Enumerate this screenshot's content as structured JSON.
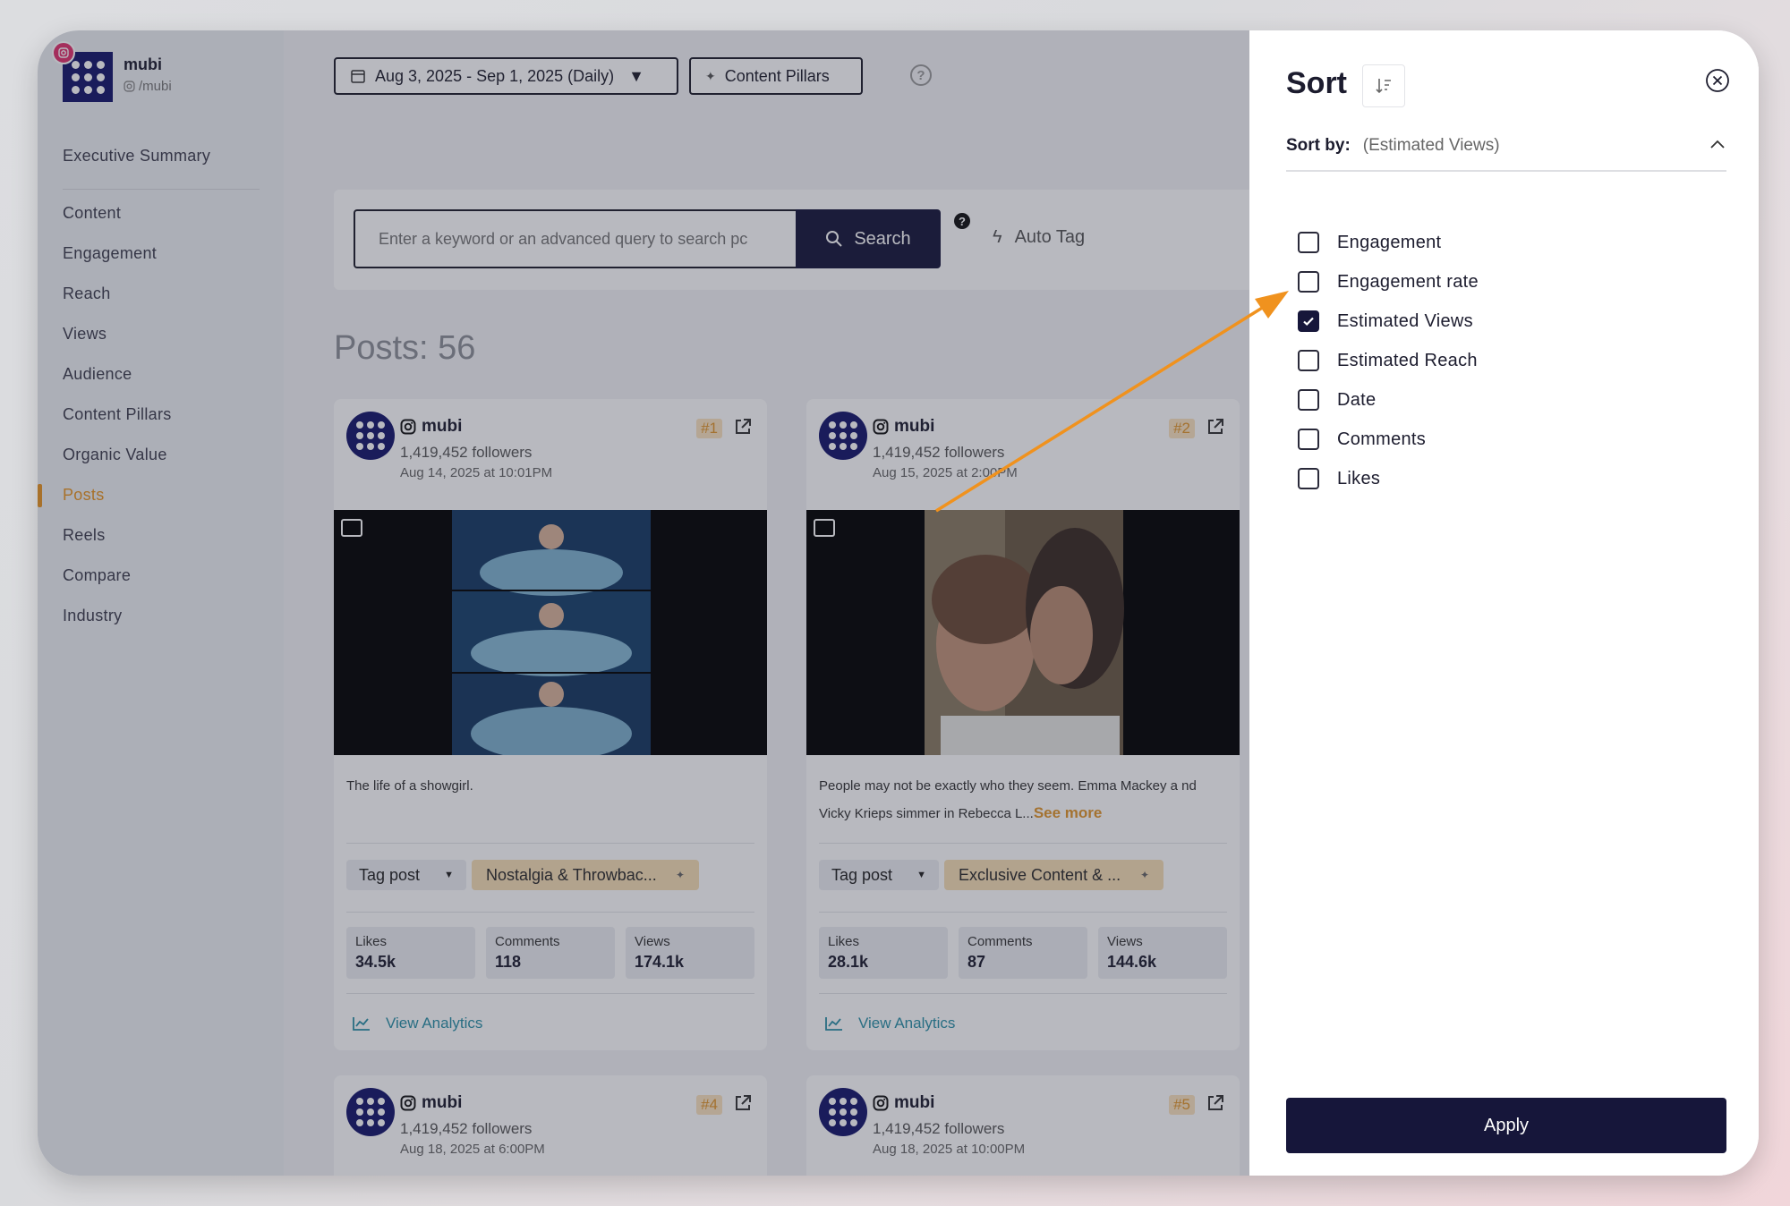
{
  "brand": {
    "name": "mubi",
    "handle": "/mubi"
  },
  "nav": {
    "items": [
      "Executive Summary",
      "Content",
      "Engagement",
      "Reach",
      "Views",
      "Audience",
      "Content Pillars",
      "Organic Value",
      "Posts",
      "Reels",
      "Compare",
      "Industry"
    ],
    "active": "Posts"
  },
  "toolbar": {
    "date_range": "Aug 3, 2025 - Sep 1, 2025 (Daily)",
    "pillars_label": "Content Pillars",
    "help": "?"
  },
  "search": {
    "placeholder": "Enter a keyword or an advanced query to search pc",
    "button_label": "Search",
    "help": "?",
    "auto_tag_label": "Auto Tag"
  },
  "posts": {
    "title": "Posts: 56",
    "cards": [
      {
        "account": "mubi",
        "followers": "1,419,452 followers",
        "date": "Aug 14, 2025 at 10:01PM",
        "rank": "#1",
        "caption": "The life of a showgirl.",
        "see_more": "",
        "tag_select": "Tag post",
        "pillar": "Nostalgia & Throwbac...",
        "stats": [
          {
            "label": "Likes",
            "value": "34.5k"
          },
          {
            "label": "Comments",
            "value": "118"
          },
          {
            "label": "Views",
            "value": "174.1k"
          }
        ],
        "analytics_label": "View Analytics"
      },
      {
        "account": "mubi",
        "followers": "1,419,452 followers",
        "date": "Aug 15, 2025 at 2:00PM",
        "rank": "#2",
        "caption": "People may not be exactly who they seem. Emma Mackey a nd Vicky Krieps simmer in Rebecca L...",
        "see_more": "See more",
        "tag_select": "Tag post",
        "pillar": "Exclusive Content & ...",
        "stats": [
          {
            "label": "Likes",
            "value": "28.1k"
          },
          {
            "label": "Comments",
            "value": "87"
          },
          {
            "label": "Views",
            "value": "144.6k"
          }
        ],
        "analytics_label": "View Analytics"
      },
      {
        "account": "mubi",
        "followers": "1,419,452 followers",
        "date": "Aug 18, 2025 at 6:00PM",
        "rank": "#4"
      },
      {
        "account": "mubi",
        "followers": "1,419,452 followers",
        "date": "Aug 18, 2025 at 10:00PM",
        "rank": "#5"
      }
    ]
  },
  "sort": {
    "title": "Sort",
    "sort_by_label": "Sort by:",
    "sort_by_value": "(Estimated Views)",
    "options": [
      {
        "label": "Engagement",
        "checked": false
      },
      {
        "label": "Engagement rate",
        "checked": false
      },
      {
        "label": "Estimated Views",
        "checked": true
      },
      {
        "label": "Estimated Reach",
        "checked": false
      },
      {
        "label": "Date",
        "checked": false
      },
      {
        "label": "Comments",
        "checked": false
      },
      {
        "label": "Likes",
        "checked": false
      }
    ],
    "apply_label": "Apply"
  },
  "colors": {
    "accent": "#e79422",
    "dark": "#16163a",
    "analytics": "#2a8fa6",
    "annotation_arrow": "#f0921e"
  }
}
